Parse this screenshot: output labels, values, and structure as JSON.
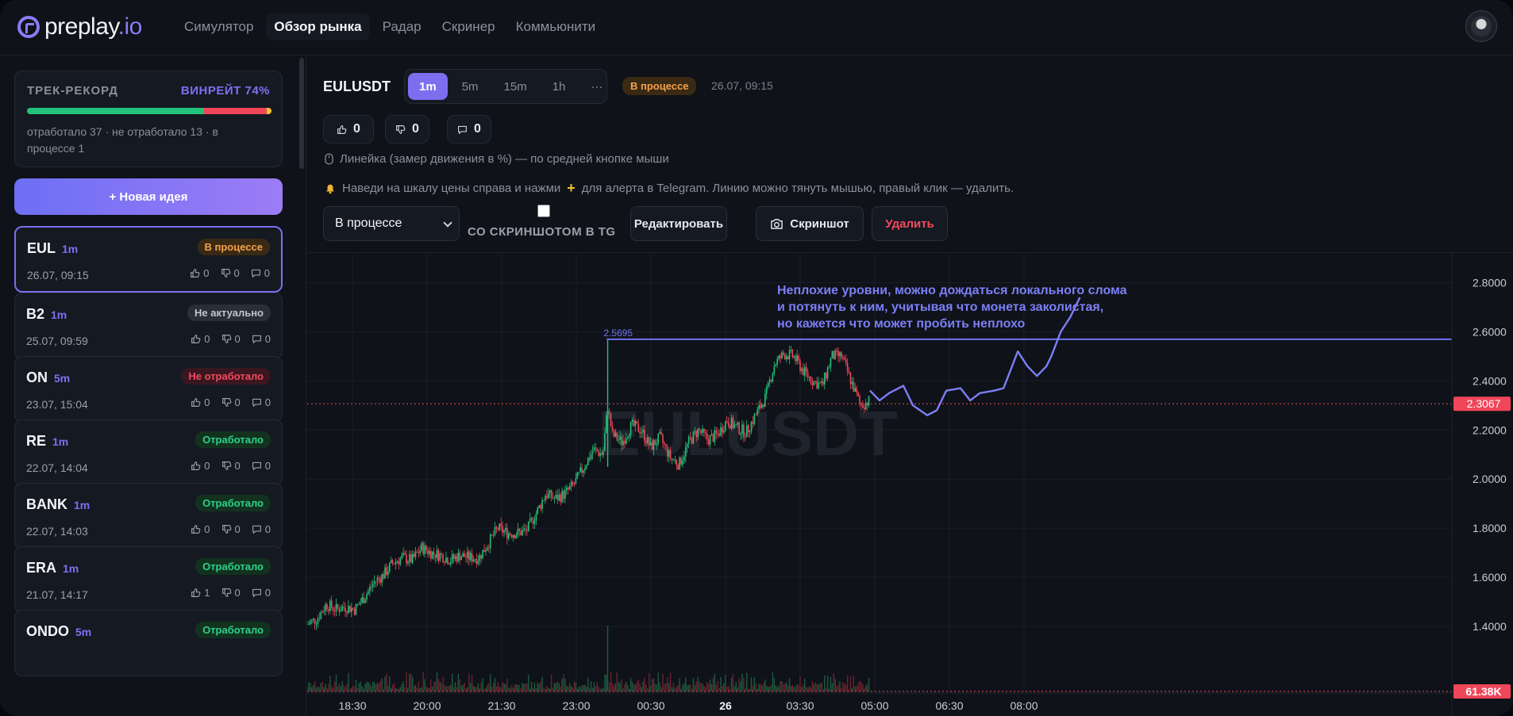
{
  "brand": {
    "name": "preplay",
    "tld": ".io"
  },
  "nav": [
    {
      "label": "Симулятор",
      "active": false
    },
    {
      "label": "Обзор рынка",
      "active": true
    },
    {
      "label": "Радар",
      "active": false
    },
    {
      "label": "Скринер",
      "active": false
    },
    {
      "label": "Коммьюнити",
      "active": false
    }
  ],
  "track": {
    "label": "ТРЕК-РЕКОРД",
    "winrate": "ВИНРЕЙТ 74%",
    "worked": 37,
    "not_worked": 13,
    "in_progress": 1,
    "stats": "отработало 37 · не отработало 13 · в процессе 1"
  },
  "new_idea_label": "+ Новая идея",
  "ideas": [
    {
      "symbol": "EUL",
      "tf": "1m",
      "status": "В процессе",
      "kind": "progress",
      "date": "26.07, 09:15",
      "likes": "0",
      "dislikes": "0",
      "comments": "0",
      "selected": true
    },
    {
      "symbol": "B2",
      "tf": "1m",
      "status": "Не актуально",
      "kind": "inactual",
      "date": "25.07, 09:59",
      "likes": "0",
      "dislikes": "0",
      "comments": "0"
    },
    {
      "symbol": "ON",
      "tf": "5m",
      "status": "Не отработало",
      "kind": "fail",
      "date": "23.07, 15:04",
      "likes": "0",
      "dislikes": "0",
      "comments": "0"
    },
    {
      "symbol": "RE",
      "tf": "1m",
      "status": "Отработало",
      "kind": "done",
      "date": "22.07, 14:04",
      "likes": "0",
      "dislikes": "0",
      "comments": "0"
    },
    {
      "symbol": "BANK",
      "tf": "1m",
      "status": "Отработало",
      "kind": "done",
      "date": "22.07, 14:03",
      "likes": "0",
      "dislikes": "0",
      "comments": "0"
    },
    {
      "symbol": "ERA",
      "tf": "1m",
      "status": "Отработало",
      "kind": "done",
      "date": "21.07, 14:17",
      "likes": "1",
      "dislikes": "0",
      "comments": "0"
    },
    {
      "symbol": "ONDO",
      "tf": "5m",
      "status": "Отработало",
      "kind": "done",
      "date": "",
      "likes": "",
      "dislikes": "",
      "comments": ""
    }
  ],
  "main": {
    "symbol": "EULUSDT",
    "timeframes": [
      "1m",
      "5m",
      "15m",
      "1h",
      "···"
    ],
    "active_tf": "1m",
    "status": "В процессе",
    "date": "26.07, 09:15",
    "likes": "0",
    "dislikes": "0",
    "comments": "0",
    "hint_ruler": "Линейка (замер движения в %) — по средней кнопке мыши",
    "hint_alert_a": "Наведи на шкалу цены справа и нажми",
    "hint_alert_plus": "+",
    "hint_alert_b": "для алерта в Telegram. Линию можно тянуть мышью, правый клик — удалить.",
    "status_select": "В процессе",
    "tg_label": "СО СКРИНШОТОМ В TG",
    "edit_label": "Редактировать",
    "screenshot_label": "Скриншот",
    "delete_label": "Удалить"
  },
  "chart_data": {
    "type": "candlestick",
    "watermark": "EULUSDT",
    "x_ticks": [
      "18:30",
      "20:00",
      "21:30",
      "23:00",
      "00:30",
      "26",
      "03:30",
      "05:00",
      "06:30",
      "08:00"
    ],
    "y_ticks": [
      "2.8000",
      "2.6000",
      "2.4000",
      "2.2000",
      "2.0000",
      "1.8000",
      "1.6000",
      "1.4000"
    ],
    "ylim": [
      1.3,
      2.85
    ],
    "last_price": "2.3067",
    "last_price_value": 2.3067,
    "volume_label": "61.38K",
    "level_label": "2.5695",
    "level_value": 2.5695,
    "annotation": [
      "Неплохие уровни, можно дождаться локального слома",
      "и потянуть к ним, учитывая что монета заколистая,",
      "но кажется что может пробить неплохо"
    ],
    "price_path": [
      [
        0,
        1.41
      ],
      [
        10,
        1.43
      ],
      [
        20,
        1.49
      ],
      [
        30,
        1.47
      ],
      [
        40,
        1.48
      ],
      [
        50,
        1.47
      ],
      [
        60,
        1.52
      ],
      [
        70,
        1.58
      ],
      [
        80,
        1.61
      ],
      [
        90,
        1.66
      ],
      [
        100,
        1.68
      ],
      [
        110,
        1.67
      ],
      [
        120,
        1.72
      ],
      [
        130,
        1.7
      ],
      [
        140,
        1.69
      ],
      [
        150,
        1.67
      ],
      [
        160,
        1.69
      ],
      [
        170,
        1.68
      ],
      [
        180,
        1.68
      ],
      [
        190,
        1.74
      ],
      [
        200,
        1.8
      ],
      [
        210,
        1.78
      ],
      [
        220,
        1.78
      ],
      [
        230,
        1.79
      ],
      [
        240,
        1.86
      ],
      [
        250,
        1.94
      ],
      [
        260,
        1.92
      ],
      [
        270,
        1.94
      ],
      [
        280,
        1.98
      ],
      [
        290,
        2.05
      ],
      [
        300,
        2.12
      ],
      [
        310,
        2.1
      ],
      [
        315,
        2.3
      ],
      [
        320,
        2.18
      ],
      [
        330,
        2.15
      ],
      [
        340,
        2.22
      ],
      [
        350,
        2.2
      ],
      [
        360,
        2.13
      ],
      [
        370,
        2.17
      ],
      [
        380,
        2.09
      ],
      [
        390,
        2.06
      ],
      [
        400,
        2.15
      ],
      [
        410,
        2.2
      ],
      [
        420,
        2.16
      ],
      [
        430,
        2.18
      ],
      [
        440,
        2.24
      ],
      [
        450,
        2.21
      ],
      [
        460,
        2.19
      ],
      [
        470,
        2.26
      ],
      [
        480,
        2.33
      ],
      [
        490,
        2.47
      ],
      [
        500,
        2.51
      ],
      [
        510,
        2.5
      ],
      [
        520,
        2.44
      ],
      [
        530,
        2.4
      ],
      [
        540,
        2.38
      ],
      [
        550,
        2.5
      ],
      [
        560,
        2.5
      ],
      [
        570,
        2.4
      ],
      [
        580,
        2.3
      ],
      [
        590,
        2.32
      ]
    ],
    "projection_path": [
      [
        590,
        2.36
      ],
      [
        600,
        2.32
      ],
      [
        610,
        2.35
      ],
      [
        625,
        2.38
      ],
      [
        635,
        2.3
      ],
      [
        650,
        2.26
      ],
      [
        660,
        2.28
      ],
      [
        670,
        2.36
      ],
      [
        685,
        2.37
      ],
      [
        695,
        2.32
      ],
      [
        705,
        2.35
      ],
      [
        720,
        2.36
      ],
      [
        730,
        2.37
      ],
      [
        745,
        2.52
      ],
      [
        755,
        2.46
      ],
      [
        765,
        2.42
      ],
      [
        775,
        2.46
      ],
      [
        780,
        2.5
      ],
      [
        790,
        2.6
      ],
      [
        800,
        2.66
      ],
      [
        810,
        2.74
      ]
    ]
  }
}
